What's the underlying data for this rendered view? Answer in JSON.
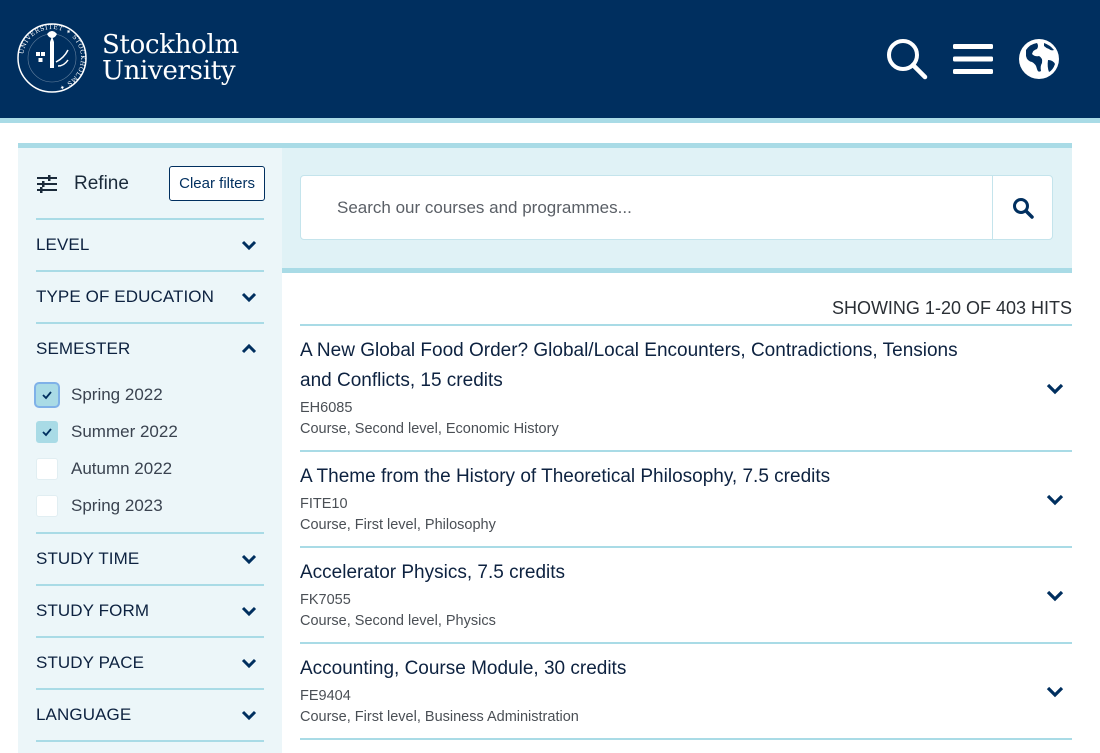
{
  "header": {
    "brand_line1": "Stockholm",
    "brand_line2": "University",
    "icons": [
      "search-icon",
      "menu-icon",
      "globe-icon"
    ],
    "colors": {
      "navy": "#002f5f",
      "accent": "#a9dbe6"
    }
  },
  "sidebar": {
    "refine_label": "Refine",
    "clear_filters": "Clear filters",
    "facets": [
      {
        "label": "LEVEL",
        "expanded": false
      },
      {
        "label": "TYPE OF EDUCATION",
        "expanded": false
      },
      {
        "label": "SEMESTER",
        "expanded": true,
        "options": [
          {
            "label": "Spring 2022",
            "checked": true
          },
          {
            "label": "Summer 2022",
            "checked": true
          },
          {
            "label": "Autumn 2022",
            "checked": false
          },
          {
            "label": "Spring 2023",
            "checked": false
          }
        ]
      },
      {
        "label": "STUDY TIME",
        "expanded": false
      },
      {
        "label": "STUDY FORM",
        "expanded": false
      },
      {
        "label": "STUDY PACE",
        "expanded": false
      },
      {
        "label": "LANGUAGE",
        "expanded": false
      }
    ]
  },
  "search": {
    "placeholder": "Search our courses and programmes...",
    "value": ""
  },
  "results": {
    "summary": "SHOWING 1-20 OF 403 HITS",
    "items": [
      {
        "title": "A New Global Food Order? Global/Local Encounters, Contradictions, Tensions and Conflicts, 15 credits",
        "code": "EH6085",
        "meta": "Course, Second level, Economic History"
      },
      {
        "title": "A Theme from the History of Theoretical Philosophy, 7.5 credits",
        "code": "FITE10",
        "meta": "Course, First level, Philosophy"
      },
      {
        "title": "Accelerator Physics, 7.5 credits",
        "code": "FK7055",
        "meta": "Course, Second level, Physics"
      },
      {
        "title": "Accounting, Course Module, 30 credits",
        "code": "FE9404",
        "meta": "Course, First level, Business Administration"
      }
    ]
  }
}
